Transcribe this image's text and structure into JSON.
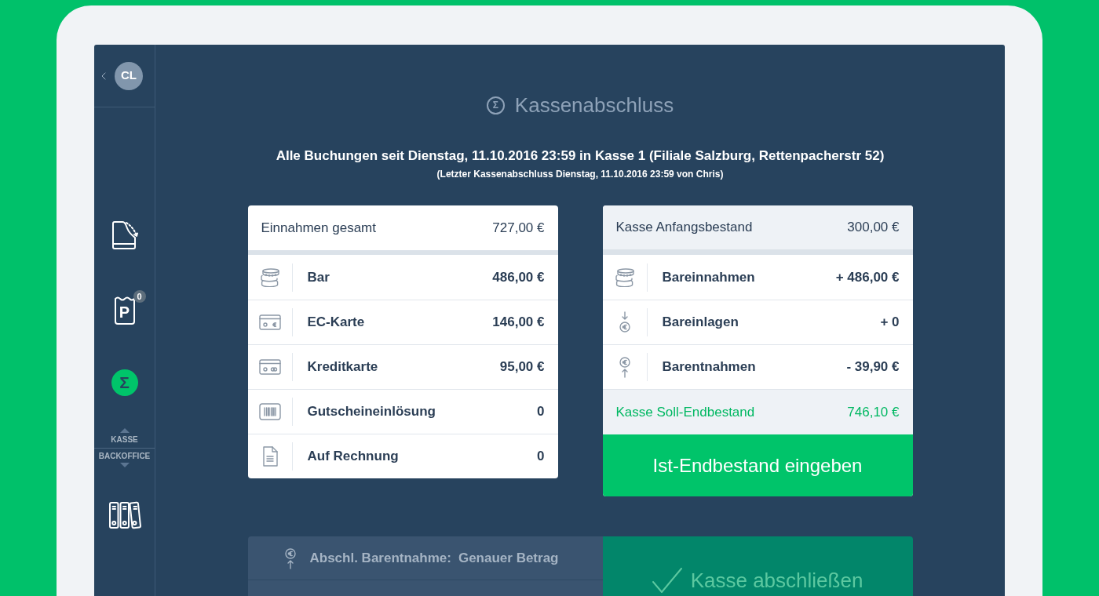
{
  "sidebar": {
    "avatar": "CL",
    "items": [
      {
        "kind": "receipt",
        "selected": false
      },
      {
        "kind": "parking",
        "glyph": "P",
        "badge": "0",
        "selected": false
      },
      {
        "kind": "sigma",
        "glyph": "Σ",
        "selected": true
      }
    ],
    "switch": {
      "upper": "KASSE",
      "lower": "BACKOFFICE"
    },
    "backoffice_items": [
      {
        "kind": "binders",
        "selected": false
      }
    ]
  },
  "header": {
    "icon_glyph": "Σ",
    "title": "Kassenabschluss",
    "subtitle": "Alle Buchungen seit Dienstag, 11.10.2016 23:59 in Kasse 1 (Filiale Salzburg, Rettenpacherstr 52)",
    "note": "(Letzter Kassenabschluss Dienstag, 11.10.2016 23:59 von Chris)"
  },
  "income": {
    "header": {
      "label": "Einnahmen gesamt",
      "value": "727,00 €"
    },
    "rows": [
      {
        "kind": "coins",
        "label": "Bar",
        "value": "486,00 €"
      },
      {
        "kind": "ec_card",
        "label": "EC-Karte",
        "value": "146,00 €"
      },
      {
        "kind": "credit_card",
        "label": "Kreditkarte",
        "value": "95,00 €"
      },
      {
        "kind": "voucher",
        "label": "Gutscheineinlösung",
        "value": "0"
      },
      {
        "kind": "invoice",
        "label": "Auf Rechnung",
        "value": "0"
      }
    ]
  },
  "cash": {
    "header": {
      "label": "Kasse Anfangsbestand",
      "value": "300,00 €"
    },
    "rows": [
      {
        "kind": "coins",
        "label": "Bareinnahmen",
        "value": "+ 486,00 €"
      },
      {
        "kind": "deposit",
        "label": "Bareinlagen",
        "value": "+ 0"
      },
      {
        "kind": "withdrawal",
        "label": "Barentnahmen",
        "value": "- 39,90 €"
      }
    ],
    "total": {
      "label": "Kasse Soll-Endbestand",
      "value": "746,10 €"
    },
    "button": "Ist-Endbestand eingeben"
  },
  "closing": {
    "options": [
      {
        "kind": "withdrawal",
        "label": "Abschl. Barentnahme:",
        "value": "Genauer Betrag"
      }
    ],
    "button": "Kasse abschließen"
  }
}
